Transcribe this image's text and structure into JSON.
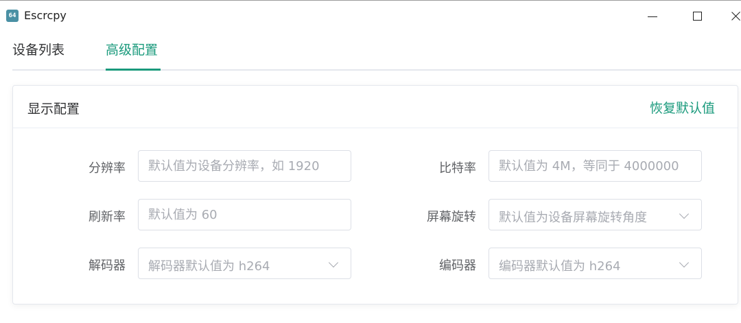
{
  "window": {
    "icon_text": "64",
    "title": "Escrcpy"
  },
  "tabs": [
    {
      "label": "设备列表",
      "active": false
    },
    {
      "label": "高级配置",
      "active": true
    }
  ],
  "card": {
    "title": "显示配置",
    "reset_label": "恢复默认值"
  },
  "form": {
    "resolution": {
      "label": "分辨率",
      "placeholder": "默认值为设备分辨率，如 1920"
    },
    "bitrate": {
      "label": "比特率",
      "placeholder": "默认值为 4M，等同于 4000000"
    },
    "refresh_rate": {
      "label": "刷新率",
      "placeholder": "默认值为 60"
    },
    "rotation": {
      "label": "屏幕旋转",
      "placeholder": "默认值为设备屏幕旋转角度"
    },
    "decoder": {
      "label": "解码器",
      "placeholder": "解码器默认值为 h264"
    },
    "encoder": {
      "label": "编码器",
      "placeholder": "编码器默认值为 h264"
    }
  },
  "colors": {
    "accent": "#1a9a7c",
    "border": "#dcdfe6",
    "placeholder": "#a8abb2"
  }
}
